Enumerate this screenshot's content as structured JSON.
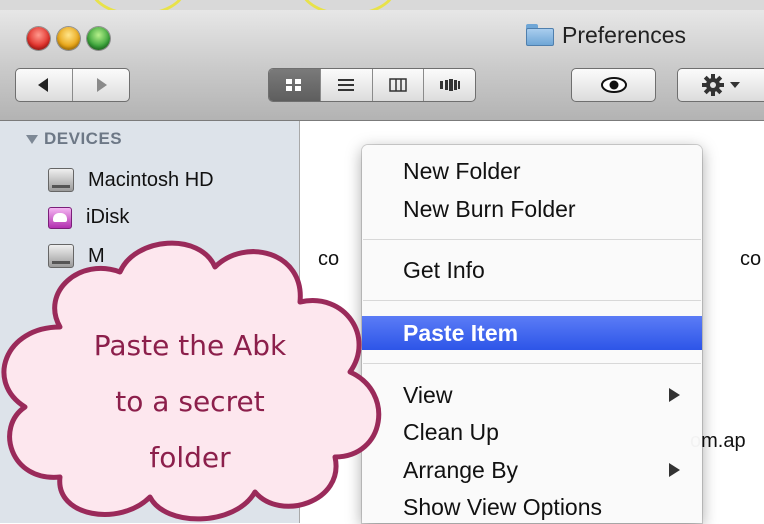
{
  "window": {
    "title": "Preferences",
    "traffic_lights": [
      "close",
      "minimize",
      "zoom"
    ]
  },
  "toolbar": {
    "back_icon": "back-arrow-icon",
    "forward_icon": "forward-arrow-icon",
    "view_icons": [
      "icon-view-icon",
      "list-view-icon",
      "column-view-icon",
      "coverflow-view-icon"
    ],
    "quicklook_icon": "eye-icon",
    "action_icon": "gear-icon"
  },
  "sidebar": {
    "heading": "DEVICES",
    "items": [
      {
        "label": "Macintosh HD",
        "icon": "hard-drive-icon"
      },
      {
        "label": "iDisk",
        "icon": "idisk-icon"
      },
      {
        "label": "M",
        "icon": "hard-drive-icon"
      }
    ]
  },
  "content": {
    "fragments": [
      "co",
      "co",
      "om.ap"
    ]
  },
  "context_menu": {
    "items": [
      {
        "label": "New Folder",
        "submenu": false
      },
      {
        "label": "New Burn Folder",
        "submenu": false
      },
      {
        "label": "Get Info",
        "submenu": false
      },
      {
        "label": "Paste Item",
        "submenu": false,
        "highlighted": true
      },
      {
        "label": "View",
        "submenu": true
      },
      {
        "label": "Clean Up",
        "submenu": false
      },
      {
        "label": "Arrange By",
        "submenu": true
      },
      {
        "label": "Show View Options",
        "submenu": false
      }
    ]
  },
  "callout": {
    "line1": "Paste the Abk",
    "line2": "to a secret",
    "line3": "folder",
    "fill": "#fde7ee",
    "stroke": "#9a2a5a"
  }
}
